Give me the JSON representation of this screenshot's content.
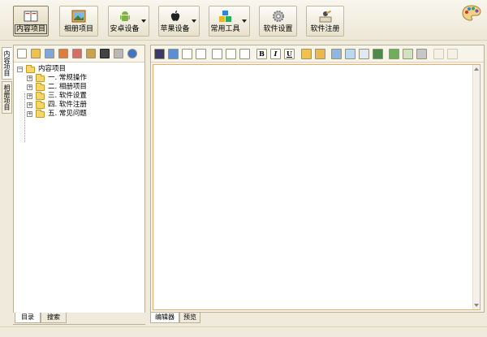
{
  "toolbar": {
    "buttons": [
      {
        "label": "内容项目",
        "icon": "book-icon",
        "active": true
      },
      {
        "label": "相册项目",
        "icon": "photo-album-icon"
      },
      {
        "label": "安卓设备",
        "icon": "android-icon",
        "dropdown": true
      },
      {
        "label": "苹果设备",
        "icon": "apple-icon",
        "dropdown": true
      },
      {
        "label": "常用工具",
        "icon": "tools-blocks-icon",
        "dropdown": true
      },
      {
        "label": "软件设置",
        "icon": "gear-icon"
      },
      {
        "label": "软件注册",
        "icon": "register-icon"
      }
    ],
    "skin_icon": "palette-icon"
  },
  "side_tabs": {
    "content": "内容项目",
    "album": "相册项目"
  },
  "left_toolbar": {
    "icons": [
      "new-file-icon",
      "open-folder-icon",
      "save-as-icon",
      "export-icon",
      "edit-icon",
      "tools-icon",
      "qr-icon",
      "sound-icon",
      "help-icon"
    ]
  },
  "tree": {
    "root": "内容项目",
    "items": [
      "一. 常规操作",
      "二. 相册项目",
      "三. 软件设置",
      "四. 软件注册",
      "五. 常见问题"
    ]
  },
  "left_tabs": {
    "toc": "目录",
    "search": "搜索"
  },
  "editor_toolbar": {
    "icons": [
      "save-icon",
      "fullscreen-icon",
      "find-icon",
      "replace-icon",
      "align-left-icon",
      "align-center-icon",
      "align-right-icon",
      "bold-icon",
      "italic-icon",
      "underline-icon",
      "image-icon",
      "text-color-icon",
      "media-icon",
      "picture-icon",
      "table-icon",
      "link-icon",
      "insert-icon",
      "export-icon",
      "clear-format-icon",
      "undo-icon",
      "redo-icon"
    ],
    "bold": "B",
    "italic": "I",
    "underline": "U"
  },
  "editor_tabs": {
    "editor": "编辑器",
    "preview": "预览"
  }
}
